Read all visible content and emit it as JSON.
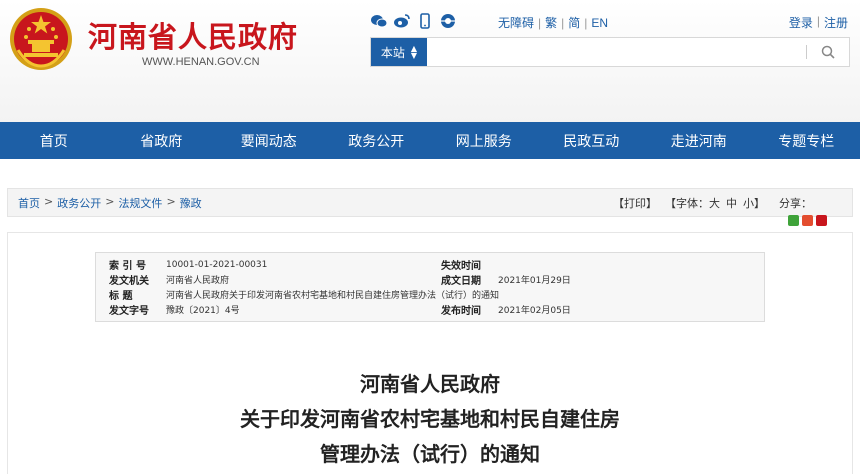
{
  "header": {
    "site_title": "河南省人民政府",
    "site_url": "WWW.HENAN.GOV.CN",
    "social_icons": [
      "wechat-icon",
      "weibo-icon",
      "mobile-icon",
      "app-icon"
    ],
    "top_links": [
      "无障碍",
      "繁",
      "简",
      "EN"
    ],
    "login": [
      "登录",
      "注册"
    ],
    "search": {
      "scope_label": "本站",
      "placeholder": ""
    }
  },
  "nav": [
    "首页",
    "省政府",
    "要闻动态",
    "政务公开",
    "网上服务",
    "民政互动",
    "走进河南",
    "专题专栏"
  ],
  "breadcrumb": [
    "首页",
    "政务公开",
    "法规文件",
    "豫政"
  ],
  "tools": {
    "print": "【打印】",
    "font_prefix": "【字体：",
    "sizes": [
      "大",
      "中",
      "小"
    ],
    "font_suffix": "】",
    "share_label": "分享："
  },
  "meta": {
    "index_label": "索 引 号",
    "index_value": "10001-01-2021-00031",
    "expiry_label": "失效时间",
    "expiry_value": "",
    "issuer_label": "发文机关",
    "issuer_value": "河南省人民政府",
    "date_label": "成文日期",
    "date_value": "2021年01月29日",
    "title_label": "标 题",
    "title_value": "河南省人民政府关于印发河南省农村宅基地和村民自建住房管理办法（试行）的通知",
    "docno_label": "发文字号",
    "docno_value": "豫政〔2021〕4号",
    "publish_label": "发布时间",
    "publish_value": "2021年02月05日"
  },
  "document": {
    "title_lines": [
      "河南省人民政府",
      "关于印发河南省农村宅基地和村民自建住房",
      "管理办法（试行）的通知"
    ]
  },
  "colors": {
    "brand_red": "#c8161d",
    "nav_blue": "#1d5fa6"
  }
}
